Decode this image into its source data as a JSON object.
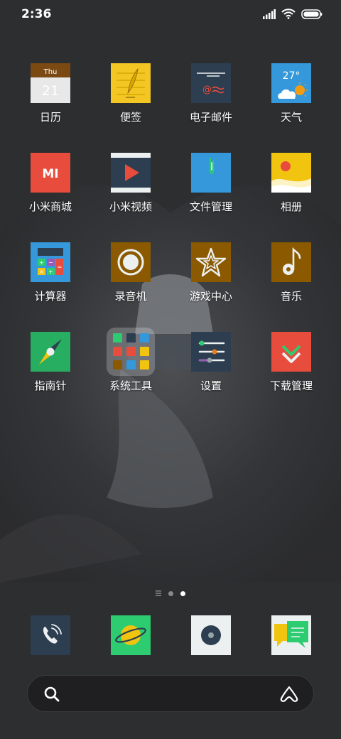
{
  "status_bar": {
    "time": "2:36",
    "icons": [
      "signal-icon",
      "wifi-icon",
      "battery-icon"
    ]
  },
  "apps": [
    {
      "label": "日历",
      "icon": "calendar-icon",
      "calendar_day": "Thu",
      "calendar_date": "21"
    },
    {
      "label": "便签",
      "icon": "notes-icon"
    },
    {
      "label": "电子邮件",
      "icon": "email-icon"
    },
    {
      "label": "天气",
      "icon": "weather-icon",
      "temperature": "27°"
    },
    {
      "label": "小米商城",
      "icon": "mi-store-icon",
      "logo_text": "MI"
    },
    {
      "label": "小米视频",
      "icon": "video-icon"
    },
    {
      "label": "文件管理",
      "icon": "file-manager-icon"
    },
    {
      "label": "相册",
      "icon": "gallery-icon"
    },
    {
      "label": "计算器",
      "icon": "calculator-icon"
    },
    {
      "label": "录音机",
      "icon": "recorder-icon"
    },
    {
      "label": "游戏中心",
      "icon": "game-center-icon"
    },
    {
      "label": "音乐",
      "icon": "music-icon"
    },
    {
      "label": "指南针",
      "icon": "compass-icon"
    },
    {
      "label": "系统工具",
      "icon": "folder-icon"
    },
    {
      "label": "设置",
      "icon": "settings-icon"
    },
    {
      "label": "下载管理",
      "icon": "downloads-icon"
    }
  ],
  "page_indicator": {
    "pages": [
      "list",
      "page-1",
      "page-2"
    ],
    "active_page": 2
  },
  "dock": [
    {
      "icon": "phone-icon"
    },
    {
      "icon": "browser-icon"
    },
    {
      "icon": "music-disc-icon"
    },
    {
      "icon": "messages-icon"
    }
  ],
  "search_bar": {
    "icons": [
      "search-icon",
      "assistant-icon"
    ]
  },
  "colors": {
    "background": "#2e2f31",
    "calendar_header": "#7a4a12",
    "notes_yellow": "#f3c623",
    "email_navy": "#2c3e50",
    "weather_blue": "#3498db",
    "mi_orange": "#e74c3c",
    "files_blue": "#3498db",
    "brown": "#8b5a00",
    "green": "#2ecc71",
    "red": "#e74c3c"
  }
}
